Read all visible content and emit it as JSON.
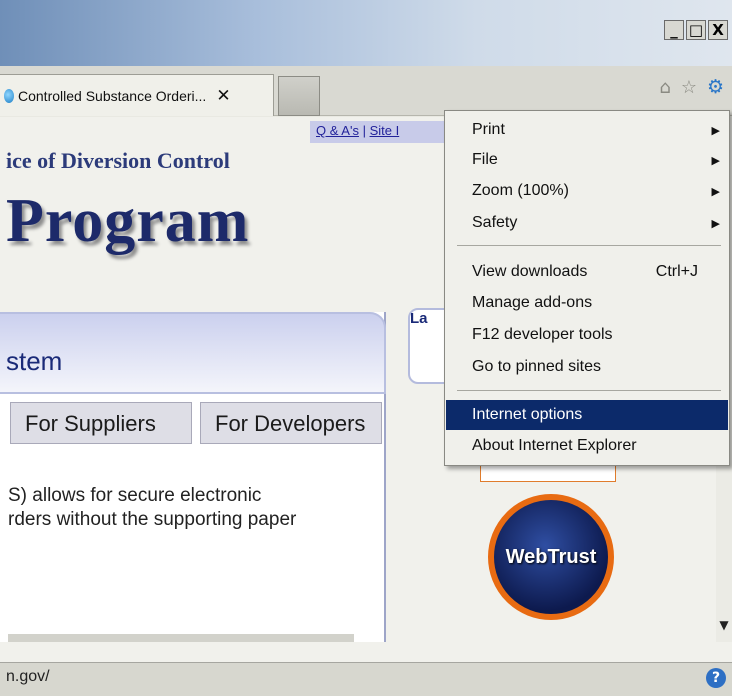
{
  "window": {
    "minimize": "_",
    "maximize": "□",
    "close": "X"
  },
  "tab": {
    "title": "Controlled Substance Orderi...",
    "close": "✕"
  },
  "toolbar": {
    "home_icon": "⌂",
    "favorites_icon": "☆",
    "tools_icon": "⚙"
  },
  "page": {
    "top_links": [
      "Q & A's",
      "Site I"
    ],
    "office_title": "ice of Diversion Control",
    "program_title": "Program",
    "system_title": "stem",
    "tabs": [
      "For Suppliers",
      "For Developers"
    ],
    "body_text_line1": "S) allows for secure electronic",
    "body_text_line2": "rders without the supporting paper",
    "latest_label": "La",
    "seal_text": "WebTrust"
  },
  "menu": {
    "items": [
      {
        "label": "Print",
        "submenu": true
      },
      {
        "label": "File",
        "submenu": true
      },
      {
        "label": "Zoom (100%)",
        "submenu": true
      },
      {
        "label": "Safety",
        "submenu": true
      },
      {
        "label": "View downloads",
        "shortcut": "Ctrl+J"
      },
      {
        "label": "Manage add-ons"
      },
      {
        "label": "F12 developer tools"
      },
      {
        "label": "Go to pinned sites"
      },
      {
        "label": "Internet options",
        "highlighted": true
      },
      {
        "label": "About Internet Explorer"
      }
    ],
    "submenu_arrow": "▶"
  },
  "status": {
    "url": "n.gov/",
    "help_icon": "?"
  },
  "colors": {
    "menu_highlight": "#0c2a6a",
    "title_navy": "#1d2a6a",
    "seal_orange": "#e86b12"
  }
}
